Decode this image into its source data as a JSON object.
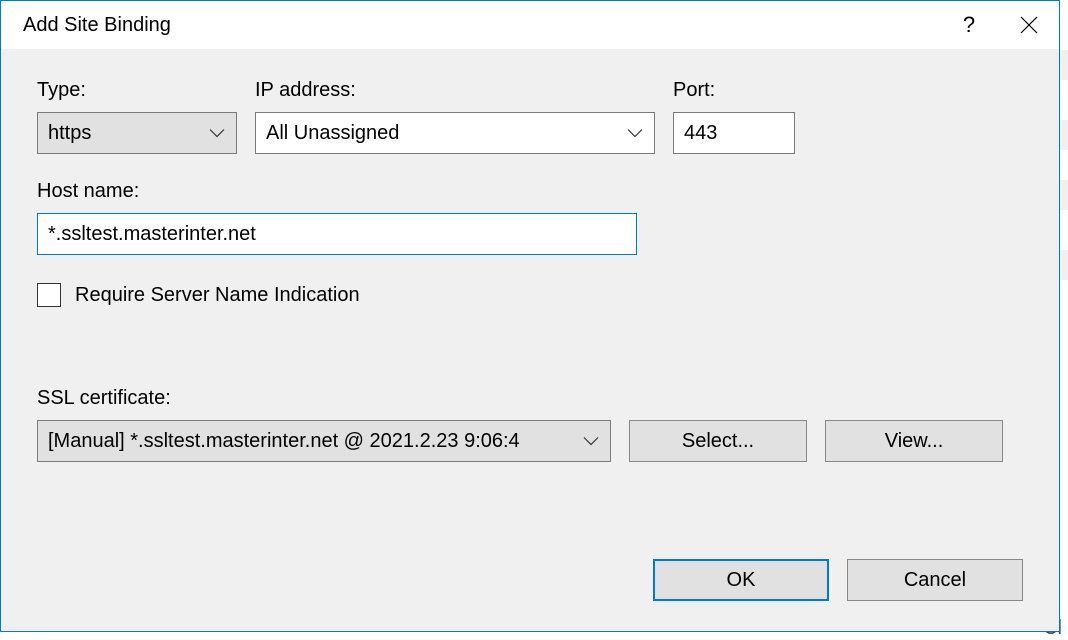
{
  "dialog": {
    "title": "Add Site Binding"
  },
  "fields": {
    "type_label": "Type:",
    "type_value": "https",
    "ip_label": "IP address:",
    "ip_value": "All Unassigned",
    "port_label": "Port:",
    "port_value": "443",
    "host_label": "Host name:",
    "host_value": "*.ssltest.masterinter.net",
    "sni_label": "Require Server Name Indication",
    "cert_label": "SSL certificate:",
    "cert_value": "[Manual] *.ssltest.masterinter.net @ 2021.2.23 9:06:4"
  },
  "buttons": {
    "select": "Select...",
    "view": "View...",
    "ok": "OK",
    "cancel": "Cancel"
  },
  "background": {
    "partial_word": "Cl"
  }
}
